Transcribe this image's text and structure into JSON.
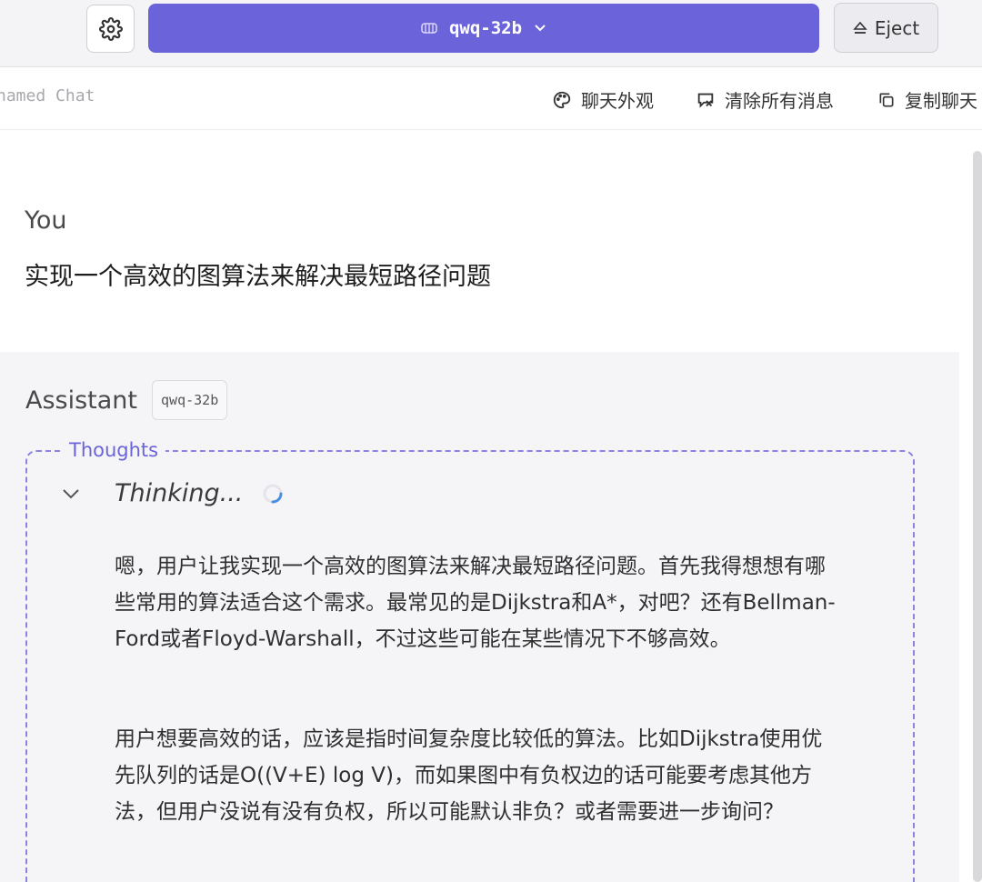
{
  "topbar": {
    "model_name": "qwq-32b",
    "eject_label": "Eject"
  },
  "chat_header": {
    "title": "named Chat",
    "actions": [
      {
        "label": "聊天外观",
        "icon": "palette-icon"
      },
      {
        "label": "清除所有消息",
        "icon": "clear-messages-icon"
      },
      {
        "label": "复制聊天",
        "icon": "copy-icon"
      }
    ]
  },
  "user_message": {
    "role": "You",
    "text": "实现一个高效的图算法来解决最短路径问题"
  },
  "assistant_message": {
    "role": "Assistant",
    "model_badge": "qwq-32b",
    "thoughts_label": "Thoughts",
    "thinking_label": "Thinking...",
    "paragraphs": [
      "嗯，用户让我实现一个高效的图算法来解决最短路径问题。首先我得想想有哪些常用的算法适合这个需求。最常见的是Dijkstra和A*，对吧？还有Bellman-Ford或者Floyd-Warshall，不过这些可能在某些情况下不够高效。",
      "用户想要高效的话，应该是指时间复杂度比较低的算法。比如Dijkstra使用优先队列的话是O((V+E) log V)，而如果图中有负权边的话可能要考虑其他方法，但用户没说有没有负权，所以可能默认非负？或者需要进一步询问？"
    ]
  },
  "colors": {
    "accent": "#6b63d9",
    "assistant_bg": "#f5f5f7"
  }
}
